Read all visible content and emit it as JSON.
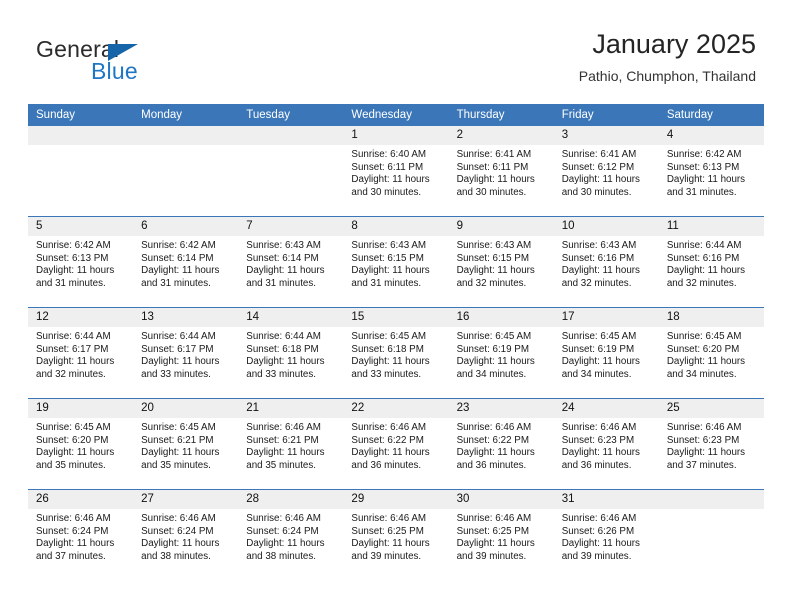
{
  "brand": {
    "name_part1": "General",
    "name_part2": "Blue",
    "triangle_icon": "triangle-icon",
    "accent_color": "#1f77c4"
  },
  "header": {
    "title": "January 2025",
    "subtitle": "Pathio, Chumphon, Thailand"
  },
  "theme": {
    "header_blue": "#3b77b8",
    "daynum_gray": "#efefef"
  },
  "weekday_headers": [
    "Sunday",
    "Monday",
    "Tuesday",
    "Wednesday",
    "Thursday",
    "Friday",
    "Saturday"
  ],
  "weeks": [
    [
      {
        "day": "",
        "empty": true,
        "sunrise": "",
        "sunset": "",
        "daylight1": "",
        "daylight2": ""
      },
      {
        "day": "",
        "empty": true,
        "sunrise": "",
        "sunset": "",
        "daylight1": "",
        "daylight2": ""
      },
      {
        "day": "",
        "empty": true,
        "sunrise": "",
        "sunset": "",
        "daylight1": "",
        "daylight2": ""
      },
      {
        "day": "1",
        "empty": false,
        "sunrise": "Sunrise: 6:40 AM",
        "sunset": "Sunset: 6:11 PM",
        "daylight1": "Daylight: 11 hours",
        "daylight2": "and 30 minutes."
      },
      {
        "day": "2",
        "empty": false,
        "sunrise": "Sunrise: 6:41 AM",
        "sunset": "Sunset: 6:11 PM",
        "daylight1": "Daylight: 11 hours",
        "daylight2": "and 30 minutes."
      },
      {
        "day": "3",
        "empty": false,
        "sunrise": "Sunrise: 6:41 AM",
        "sunset": "Sunset: 6:12 PM",
        "daylight1": "Daylight: 11 hours",
        "daylight2": "and 30 minutes."
      },
      {
        "day": "4",
        "empty": false,
        "sunrise": "Sunrise: 6:42 AM",
        "sunset": "Sunset: 6:13 PM",
        "daylight1": "Daylight: 11 hours",
        "daylight2": "and 31 minutes."
      }
    ],
    [
      {
        "day": "5",
        "empty": false,
        "sunrise": "Sunrise: 6:42 AM",
        "sunset": "Sunset: 6:13 PM",
        "daylight1": "Daylight: 11 hours",
        "daylight2": "and 31 minutes."
      },
      {
        "day": "6",
        "empty": false,
        "sunrise": "Sunrise: 6:42 AM",
        "sunset": "Sunset: 6:14 PM",
        "daylight1": "Daylight: 11 hours",
        "daylight2": "and 31 minutes."
      },
      {
        "day": "7",
        "empty": false,
        "sunrise": "Sunrise: 6:43 AM",
        "sunset": "Sunset: 6:14 PM",
        "daylight1": "Daylight: 11 hours",
        "daylight2": "and 31 minutes."
      },
      {
        "day": "8",
        "empty": false,
        "sunrise": "Sunrise: 6:43 AM",
        "sunset": "Sunset: 6:15 PM",
        "daylight1": "Daylight: 11 hours",
        "daylight2": "and 31 minutes."
      },
      {
        "day": "9",
        "empty": false,
        "sunrise": "Sunrise: 6:43 AM",
        "sunset": "Sunset: 6:15 PM",
        "daylight1": "Daylight: 11 hours",
        "daylight2": "and 32 minutes."
      },
      {
        "day": "10",
        "empty": false,
        "sunrise": "Sunrise: 6:43 AM",
        "sunset": "Sunset: 6:16 PM",
        "daylight1": "Daylight: 11 hours",
        "daylight2": "and 32 minutes."
      },
      {
        "day": "11",
        "empty": false,
        "sunrise": "Sunrise: 6:44 AM",
        "sunset": "Sunset: 6:16 PM",
        "daylight1": "Daylight: 11 hours",
        "daylight2": "and 32 minutes."
      }
    ],
    [
      {
        "day": "12",
        "empty": false,
        "sunrise": "Sunrise: 6:44 AM",
        "sunset": "Sunset: 6:17 PM",
        "daylight1": "Daylight: 11 hours",
        "daylight2": "and 32 minutes."
      },
      {
        "day": "13",
        "empty": false,
        "sunrise": "Sunrise: 6:44 AM",
        "sunset": "Sunset: 6:17 PM",
        "daylight1": "Daylight: 11 hours",
        "daylight2": "and 33 minutes."
      },
      {
        "day": "14",
        "empty": false,
        "sunrise": "Sunrise: 6:44 AM",
        "sunset": "Sunset: 6:18 PM",
        "daylight1": "Daylight: 11 hours",
        "daylight2": "and 33 minutes."
      },
      {
        "day": "15",
        "empty": false,
        "sunrise": "Sunrise: 6:45 AM",
        "sunset": "Sunset: 6:18 PM",
        "daylight1": "Daylight: 11 hours",
        "daylight2": "and 33 minutes."
      },
      {
        "day": "16",
        "empty": false,
        "sunrise": "Sunrise: 6:45 AM",
        "sunset": "Sunset: 6:19 PM",
        "daylight1": "Daylight: 11 hours",
        "daylight2": "and 34 minutes."
      },
      {
        "day": "17",
        "empty": false,
        "sunrise": "Sunrise: 6:45 AM",
        "sunset": "Sunset: 6:19 PM",
        "daylight1": "Daylight: 11 hours",
        "daylight2": "and 34 minutes."
      },
      {
        "day": "18",
        "empty": false,
        "sunrise": "Sunrise: 6:45 AM",
        "sunset": "Sunset: 6:20 PM",
        "daylight1": "Daylight: 11 hours",
        "daylight2": "and 34 minutes."
      }
    ],
    [
      {
        "day": "19",
        "empty": false,
        "sunrise": "Sunrise: 6:45 AM",
        "sunset": "Sunset: 6:20 PM",
        "daylight1": "Daylight: 11 hours",
        "daylight2": "and 35 minutes."
      },
      {
        "day": "20",
        "empty": false,
        "sunrise": "Sunrise: 6:45 AM",
        "sunset": "Sunset: 6:21 PM",
        "daylight1": "Daylight: 11 hours",
        "daylight2": "and 35 minutes."
      },
      {
        "day": "21",
        "empty": false,
        "sunrise": "Sunrise: 6:46 AM",
        "sunset": "Sunset: 6:21 PM",
        "daylight1": "Daylight: 11 hours",
        "daylight2": "and 35 minutes."
      },
      {
        "day": "22",
        "empty": false,
        "sunrise": "Sunrise: 6:46 AM",
        "sunset": "Sunset: 6:22 PM",
        "daylight1": "Daylight: 11 hours",
        "daylight2": "and 36 minutes."
      },
      {
        "day": "23",
        "empty": false,
        "sunrise": "Sunrise: 6:46 AM",
        "sunset": "Sunset: 6:22 PM",
        "daylight1": "Daylight: 11 hours",
        "daylight2": "and 36 minutes."
      },
      {
        "day": "24",
        "empty": false,
        "sunrise": "Sunrise: 6:46 AM",
        "sunset": "Sunset: 6:23 PM",
        "daylight1": "Daylight: 11 hours",
        "daylight2": "and 36 minutes."
      },
      {
        "day": "25",
        "empty": false,
        "sunrise": "Sunrise: 6:46 AM",
        "sunset": "Sunset: 6:23 PM",
        "daylight1": "Daylight: 11 hours",
        "daylight2": "and 37 minutes."
      }
    ],
    [
      {
        "day": "26",
        "empty": false,
        "sunrise": "Sunrise: 6:46 AM",
        "sunset": "Sunset: 6:24 PM",
        "daylight1": "Daylight: 11 hours",
        "daylight2": "and 37 minutes."
      },
      {
        "day": "27",
        "empty": false,
        "sunrise": "Sunrise: 6:46 AM",
        "sunset": "Sunset: 6:24 PM",
        "daylight1": "Daylight: 11 hours",
        "daylight2": "and 38 minutes."
      },
      {
        "day": "28",
        "empty": false,
        "sunrise": "Sunrise: 6:46 AM",
        "sunset": "Sunset: 6:24 PM",
        "daylight1": "Daylight: 11 hours",
        "daylight2": "and 38 minutes."
      },
      {
        "day": "29",
        "empty": false,
        "sunrise": "Sunrise: 6:46 AM",
        "sunset": "Sunset: 6:25 PM",
        "daylight1": "Daylight: 11 hours",
        "daylight2": "and 39 minutes."
      },
      {
        "day": "30",
        "empty": false,
        "sunrise": "Sunrise: 6:46 AM",
        "sunset": "Sunset: 6:25 PM",
        "daylight1": "Daylight: 11 hours",
        "daylight2": "and 39 minutes."
      },
      {
        "day": "31",
        "empty": false,
        "sunrise": "Sunrise: 6:46 AM",
        "sunset": "Sunset: 6:26 PM",
        "daylight1": "Daylight: 11 hours",
        "daylight2": "and 39 minutes."
      },
      {
        "day": "",
        "empty": true,
        "sunrise": "",
        "sunset": "",
        "daylight1": "",
        "daylight2": ""
      }
    ]
  ]
}
